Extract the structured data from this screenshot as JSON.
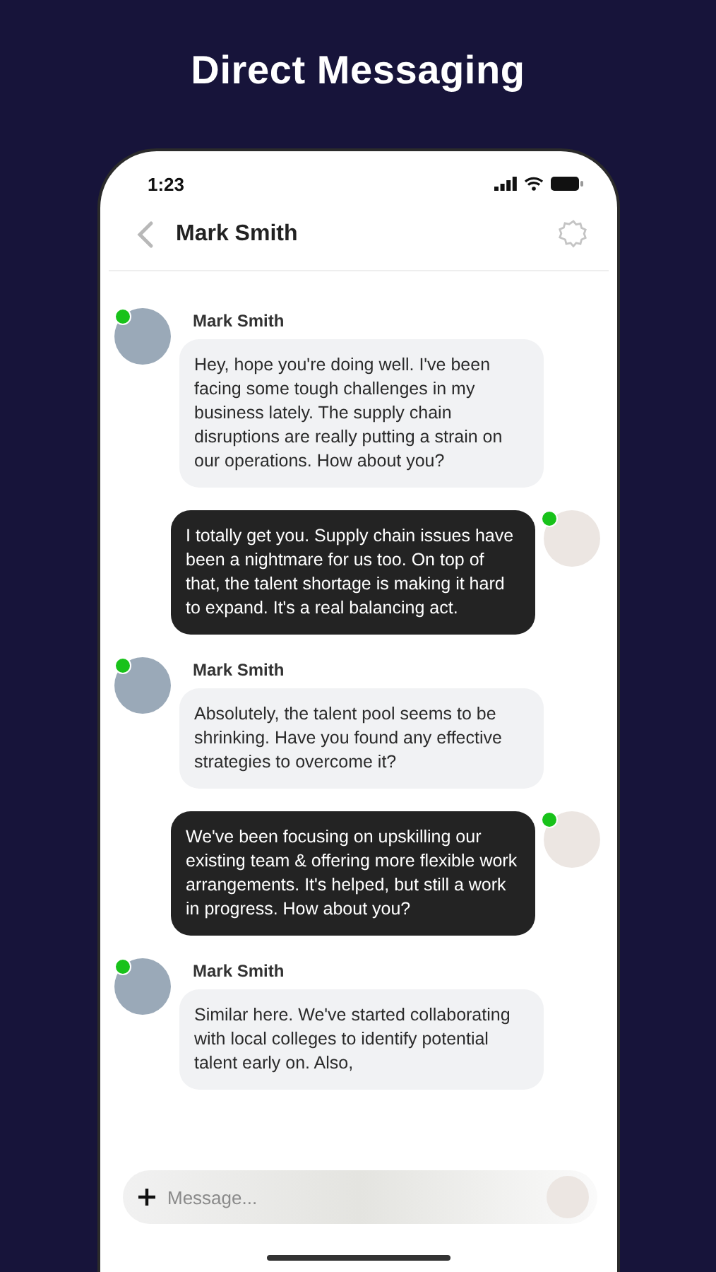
{
  "page_title": "Direct Messaging",
  "status_bar": {
    "time": "1:23"
  },
  "header": {
    "title": "Mark Smith"
  },
  "messages": [
    {
      "kind": "incoming",
      "sender": "Mark Smith",
      "online": true,
      "text": "Hey, hope you're doing well. I've been facing some tough challenges in my business lately. The supply chain disruptions are really putting a strain on our operations. How about you?"
    },
    {
      "kind": "outgoing",
      "online": true,
      "text": "I totally get you. Supply chain issues have been a nightmare for us too. On top of that, the talent shortage is making it hard to expand. It's a real balancing act."
    },
    {
      "kind": "incoming",
      "sender": "Mark Smith",
      "online": true,
      "text": "Absolutely, the talent pool seems to be shrinking. Have you found any effective strategies to overcome it?"
    },
    {
      "kind": "outgoing",
      "online": true,
      "text": "We've been focusing on upskilling our existing team & offering more flexible work arrangements. It's helped, but still a work in progress. How about you?"
    },
    {
      "kind": "incoming",
      "sender": "Mark Smith",
      "online": true,
      "text": "Similar here. We've started collaborating with local colleges to identify potential talent early on. Also,"
    }
  ],
  "composer": {
    "placeholder": "Message..."
  }
}
